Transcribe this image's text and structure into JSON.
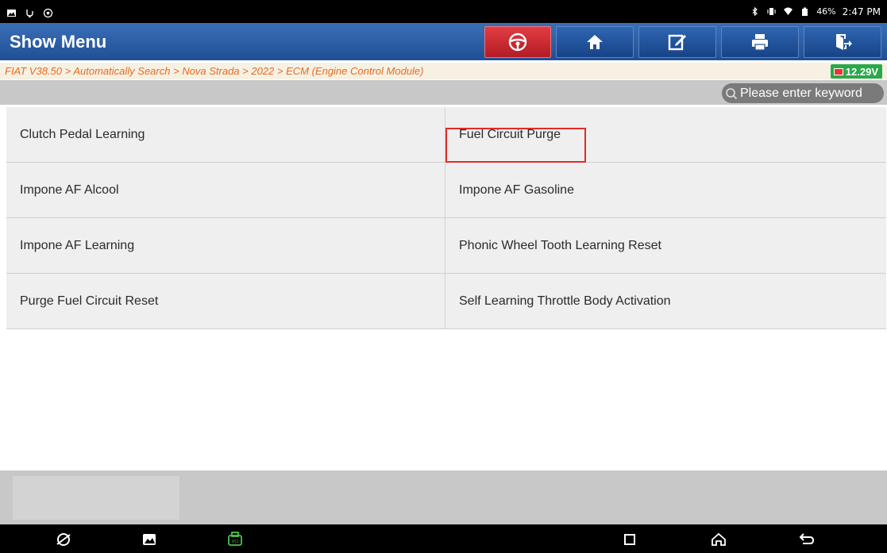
{
  "statusbar": {
    "left_icons": [
      "photo-icon",
      "usb-debug-icon",
      "settings-gear-icon"
    ],
    "battery": "46%",
    "time": "2:47 PM"
  },
  "titlebar": {
    "title": "Show Menu",
    "buttons": [
      "steering-wheel-icon",
      "home-icon",
      "edit-icon",
      "print-icon",
      "exit-icon"
    ]
  },
  "breadcrumb": {
    "text": "FIAT V38.50 > Automatically Search > Nova Strada > 2022 > ECM (Engine Control Module)",
    "voltage": "12.29V"
  },
  "search": {
    "placeholder": "Please enter keyword"
  },
  "menu": {
    "items": [
      {
        "label": "Clutch Pedal Learning"
      },
      {
        "label": "Fuel Circuit Purge"
      },
      {
        "label": "Impone AF Alcool"
      },
      {
        "label": "Impone AF Gasoline"
      },
      {
        "label": "Impone AF Learning"
      },
      {
        "label": "Phonic Wheel Tooth Learning Reset"
      },
      {
        "label": "Purge Fuel Circuit Reset"
      },
      {
        "label": "Self Learning Throttle Body Activation"
      }
    ],
    "selected_index": 1
  },
  "navbar": {
    "left_icons": [
      "browser-icon",
      "gallery-icon",
      "vci-icon"
    ],
    "right_icons": [
      "recent-apps-icon",
      "home-nav-icon",
      "back-icon"
    ]
  },
  "colors": {
    "title_bar": "#2a5ea6",
    "breadcrumb_text": "#e56b1f",
    "voltage_badge": "#2aa84a",
    "selection_border": "#e02a2a"
  }
}
